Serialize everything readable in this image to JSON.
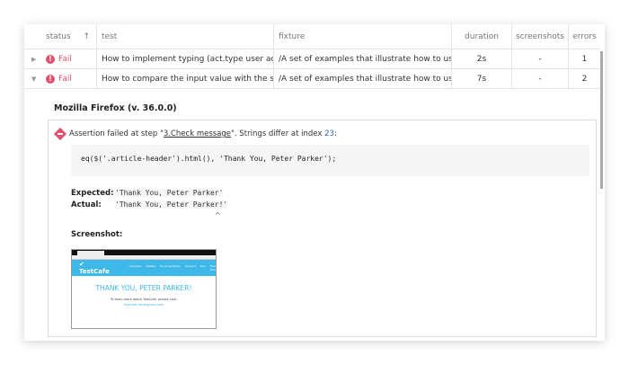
{
  "table": {
    "headers": {
      "status": "status",
      "sort": "↑",
      "test": "test",
      "fixture": "fixture",
      "duration": "duration",
      "screenshots": "screenshots",
      "errors": "errors"
    },
    "rows": [
      {
        "status": "Fail",
        "test": "How to implement typing (act.type user act...",
        "fixture": "/A set of examples that illustrate how to us...",
        "duration": "2s",
        "screenshots": "-",
        "errors": "1",
        "expanded": false
      },
      {
        "status": "Fail",
        "test": "How to compare the input value with the s...",
        "fixture": "/A set of examples that illustrate how to us...",
        "duration": "7s",
        "screenshots": "-",
        "errors": "2",
        "expanded": true
      }
    ]
  },
  "detail": {
    "browser": "Mozilla Firefox (v. 36.0.0)",
    "assert_prefix": "Assertion failed at step \"",
    "step_link": "3.Check message",
    "assert_mid": "\". Strings differ at index ",
    "index": "23",
    "assert_suffix": ":",
    "code": "eq($('.article-header').html(), 'Thank You, Peter Parker');",
    "expected_label": "Expected:",
    "expected": "'Thank You, Peter Parker'",
    "actual_label": "Actual:",
    "actual": "'Thank You, Peter Parker!'",
    "caret": "^",
    "screenshot_label": "Screenshot:",
    "screenshot": {
      "logo": "TestCafe",
      "nav": [
        "Overview",
        "Details",
        "Documentation",
        "Support",
        "Buy",
        "Free Trial"
      ],
      "heading": "THANK YOU, PETER PARKER!",
      "text": "To learn more about TestCafe, please visit:",
      "link": "testcafe.devexpress.com"
    }
  },
  "colors": {
    "fail": "#e0516f",
    "brand": "#3db8e8"
  }
}
